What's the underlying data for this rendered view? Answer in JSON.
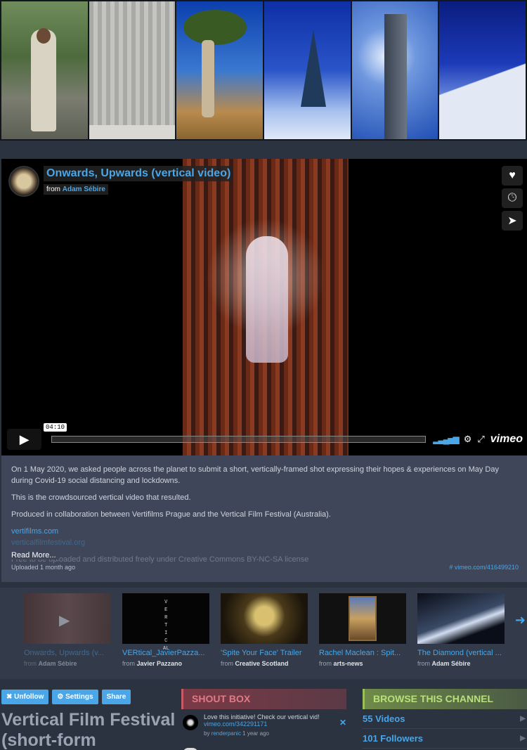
{
  "banner": {
    "tiles": [
      "man-in-garden",
      "ornate-door",
      "baobab-trees",
      "snow-forest",
      "skyscraper",
      "snow-climber"
    ]
  },
  "video": {
    "title": "Onwards, Upwards (vertical video)",
    "from_prefix": "from",
    "author": "Adam Sébire",
    "time": "04:10",
    "brand": "vimeo",
    "side_icons": [
      "heart-icon",
      "clock-icon",
      "send-icon"
    ],
    "description": [
      "On 1 May 2020, we asked people across the planet to submit a short, vertically-framed shot expressing their hopes & experiences on May Day during Covid-19 social distancing and lockdowns.",
      "This is the crowdsourced vertical video that resulted.",
      "Produced in collaboration between Vertifilms Prague and the Vertical Film Festival (Australia)."
    ],
    "links": [
      "vertifilms.com",
      "verticalfilmfestival.org"
    ],
    "faded_text": "Free to be uploaded and distributed freely under Creative Commons BY-NC-SA license",
    "read_more": "Read More...",
    "uploaded": "Uploaded 1 month ago",
    "vid_link": "# vimeo.com/416499210"
  },
  "related": [
    {
      "title": "Onwards, Upwards (v...",
      "from": "from",
      "author": "Adam Sébire"
    },
    {
      "title": "VERtical_JavierPazza...",
      "from": "from",
      "author": "Javier Pazzano"
    },
    {
      "title": "'Spite Your Face' Trailer",
      "from": "from",
      "author": "Creative Scotland"
    },
    {
      "title": "Rachel Maclean : Spit...",
      "from": "from",
      "author": "arts-news"
    },
    {
      "title": "The Diamond (vertical ...",
      "from": "from",
      "author": "Adam Sébire"
    }
  ],
  "related_thumb_text": "V\nE\nR\nT\nI\nC\nAL",
  "buttons": {
    "unfollow": "✖ Unfollow",
    "settings": "⚙ Settings",
    "share": "Share"
  },
  "channel_title": "Vertical Film Festival (short-form",
  "shoutbox": {
    "heading": "SHOUT BOX",
    "messages": [
      {
        "text": "Love this initiative! Check our vertical vid!",
        "link": "vimeo.com/342291171",
        "by": "by",
        "user": "renderpanic",
        "when": "1 year ago"
      }
    ]
  },
  "browse": {
    "heading": "BROWSE THIS CHANNEL",
    "rows": [
      {
        "label": "55 Videos"
      },
      {
        "label": "101 Followers"
      }
    ]
  },
  "colors": {
    "accent": "#4aa6e6",
    "background": "#2b3240",
    "card": "#3f4659"
  }
}
